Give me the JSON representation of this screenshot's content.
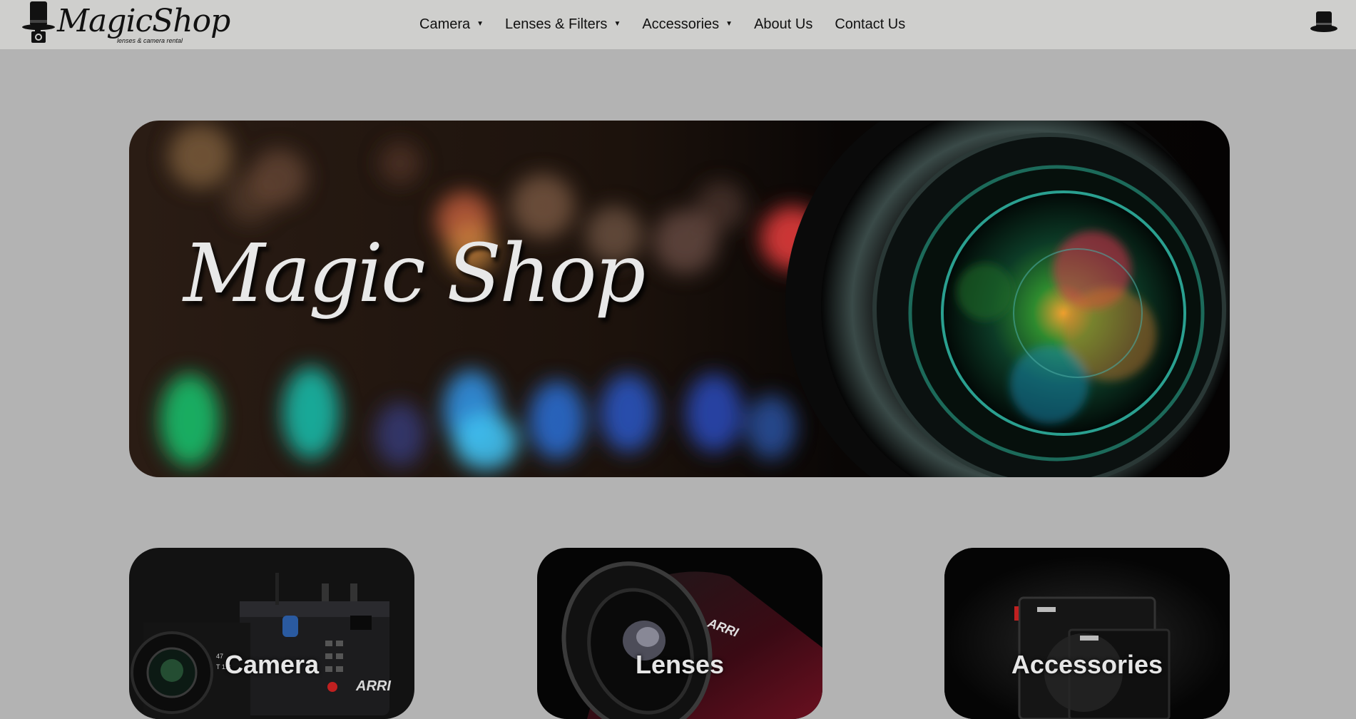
{
  "header": {
    "brand": "MagicShop",
    "tagline": "lenses & camera rental",
    "nav": [
      {
        "label": "Camera",
        "dropdown": true
      },
      {
        "label": "Lenses & Filters",
        "dropdown": true
      },
      {
        "label": "Accessories",
        "dropdown": true
      },
      {
        "label": "About Us",
        "dropdown": false
      },
      {
        "label": "Contact Us",
        "dropdown": false
      }
    ],
    "cart_icon": "top-hat-icon"
  },
  "hero": {
    "title": "Magic Shop"
  },
  "categories": [
    {
      "label": "Camera",
      "brand_mark": "ARRI"
    },
    {
      "label": "Lenses",
      "brand_mark": "ARRI"
    },
    {
      "label": "Accessories",
      "brand_mark": ""
    }
  ],
  "colors": {
    "page_background": "#b3b3b3",
    "navbar_background": "#cfcfcd",
    "text": "#111111",
    "card_label": "#e6e6e6"
  }
}
